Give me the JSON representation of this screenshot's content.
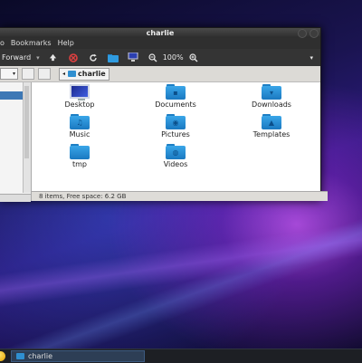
{
  "window": {
    "title": "charlie",
    "menu": [
      "o",
      "Bookmarks",
      "Help"
    ],
    "toolbar": {
      "forward_label": "Forward",
      "zoom_level": "100%",
      "icons": [
        "up-arrow-icon",
        "stop-icon",
        "reload-icon",
        "home-folder-icon",
        "computer-icon",
        "zoom-out-icon",
        "zoom-in-icon"
      ]
    },
    "location": {
      "crumb": "charlie"
    },
    "files": [
      {
        "name": "Desktop",
        "icon": "desktop-icon"
      },
      {
        "name": "Documents",
        "icon": "documents-folder-icon"
      },
      {
        "name": "Downloads",
        "icon": "downloads-folder-icon"
      },
      {
        "name": "Music",
        "icon": "music-folder-icon"
      },
      {
        "name": "Pictures",
        "icon": "pictures-folder-icon"
      },
      {
        "name": "Templates",
        "icon": "templates-folder-icon"
      },
      {
        "name": "tmp",
        "icon": "folder-icon"
      },
      {
        "name": "Videos",
        "icon": "videos-folder-icon"
      }
    ],
    "status": "8 items, Free space: 6.2 GB"
  },
  "taskbar": {
    "task_label": "charlie"
  },
  "colors": {
    "folder": "#2a8fd6",
    "selection": "#3d78b5",
    "taskbar": "#1d1f24"
  }
}
